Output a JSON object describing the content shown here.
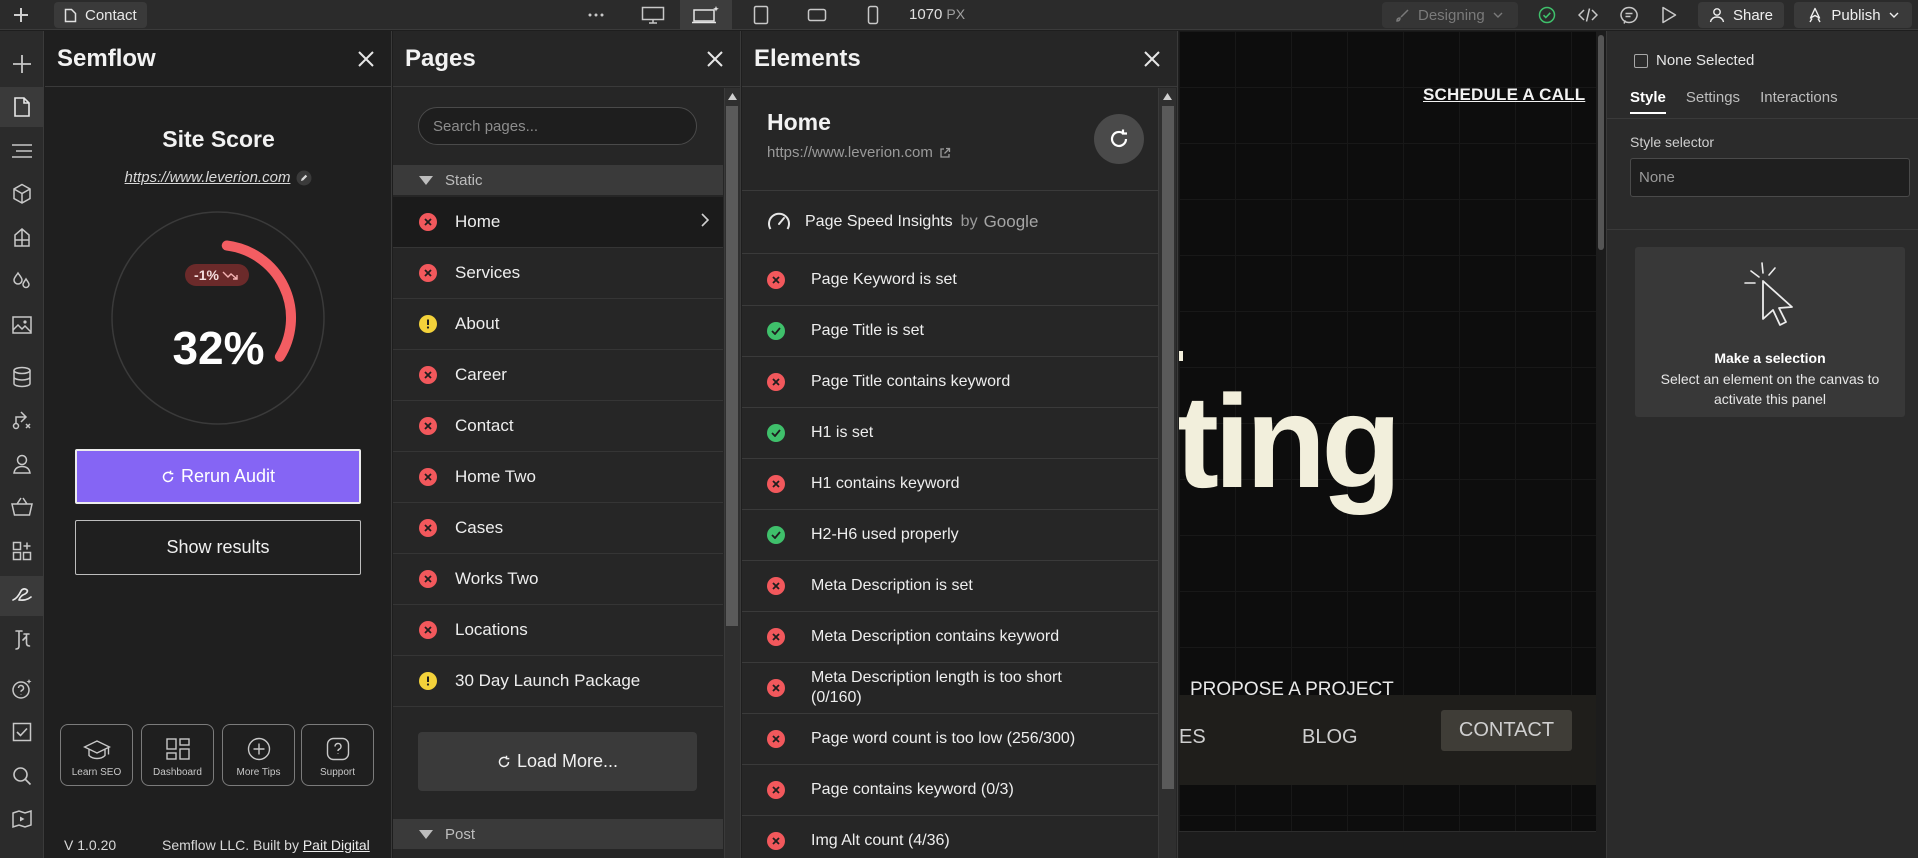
{
  "topbar": {
    "page_name": "Contact",
    "breakpoint_width": "1070",
    "breakpoint_unit": "PX",
    "mode": "Designing",
    "share_label": "Share",
    "publish_label": "Publish"
  },
  "semflow": {
    "title": "Semflow",
    "site_score_label": "Site Score",
    "site_url": "https://www.leverion.com",
    "score_percent": "32%",
    "score_fraction": 0.32,
    "score_trend": "-1%",
    "rerun_label": "Rerun Audit",
    "show_results_label": "Show results",
    "tools": [
      {
        "label": "Learn SEO",
        "icon": "graduation-cap-icon"
      },
      {
        "label": "Dashboard",
        "icon": "dashboard-icon"
      },
      {
        "label": "More Tips",
        "icon": "plus-circle-icon"
      },
      {
        "label": "Support",
        "icon": "question-icon"
      }
    ],
    "version": "V 1.0.20",
    "credit_text": "Semflow LLC. Built by ",
    "credit_link": "Pait Digital"
  },
  "pages": {
    "title": "Pages",
    "search_placeholder": "Search pages...",
    "static_group": "Static",
    "post_group": "Post",
    "items": [
      {
        "name": "Home",
        "status": "error"
      },
      {
        "name": "Services",
        "status": "error"
      },
      {
        "name": "About",
        "status": "warn"
      },
      {
        "name": "Career",
        "status": "error"
      },
      {
        "name": "Contact",
        "status": "error"
      },
      {
        "name": "Home Two",
        "status": "error"
      },
      {
        "name": "Cases",
        "status": "error"
      },
      {
        "name": "Works Two",
        "status": "error"
      },
      {
        "name": "Locations",
        "status": "error"
      },
      {
        "name": "30 Day Launch Package",
        "status": "warn"
      }
    ],
    "load_more_label": "Load More..."
  },
  "elements": {
    "title": "Elements",
    "page_title": "Home",
    "page_url": "https://www.leverion.com",
    "psi_label": "Page Speed Insights",
    "psi_by": "by",
    "psi_brand": "Google",
    "checks": [
      {
        "label": "Page Keyword is set",
        "status": "error"
      },
      {
        "label": "Page Title is set",
        "status": "ok"
      },
      {
        "label": "Page Title contains keyword",
        "status": "error"
      },
      {
        "label": "H1 is set",
        "status": "ok"
      },
      {
        "label": "H1 contains keyword",
        "status": "error"
      },
      {
        "label": "H2-H6 used properly",
        "status": "ok"
      },
      {
        "label": "Meta Description is set",
        "status": "error"
      },
      {
        "label": "Meta Description contains keyword",
        "status": "error"
      },
      {
        "label": "Meta Description length is too short (0/160)",
        "status": "error"
      },
      {
        "label": "Page word count is too low (256/300)",
        "status": "error"
      },
      {
        "label": "Page contains keyword (0/3)",
        "status": "error"
      },
      {
        "label": "Img Alt count (4/36)",
        "status": "error"
      }
    ]
  },
  "canvas": {
    "schedule_link": "SCHEDULE A CALL",
    "hero_word": "ting",
    "propose_link": "PROPOSE A PROJECT",
    "nav_partial": "ES",
    "nav_blog": "BLOG",
    "nav_contact": "CONTACT"
  },
  "right_panel": {
    "selection_label": "None Selected",
    "tabs": [
      "Style",
      "Settings",
      "Interactions"
    ],
    "style_selector_label": "Style selector",
    "style_selector_value": "None",
    "empty_title": "Make a selection",
    "empty_desc": "Select an element on the canvas to activate this panel"
  },
  "colors": {
    "accent_purple": "#8565f4",
    "error_red": "#f2585c",
    "ok_green": "#3fc06b",
    "warn_yellow": "#f3d23a",
    "gauge_red": "#f35d62"
  }
}
